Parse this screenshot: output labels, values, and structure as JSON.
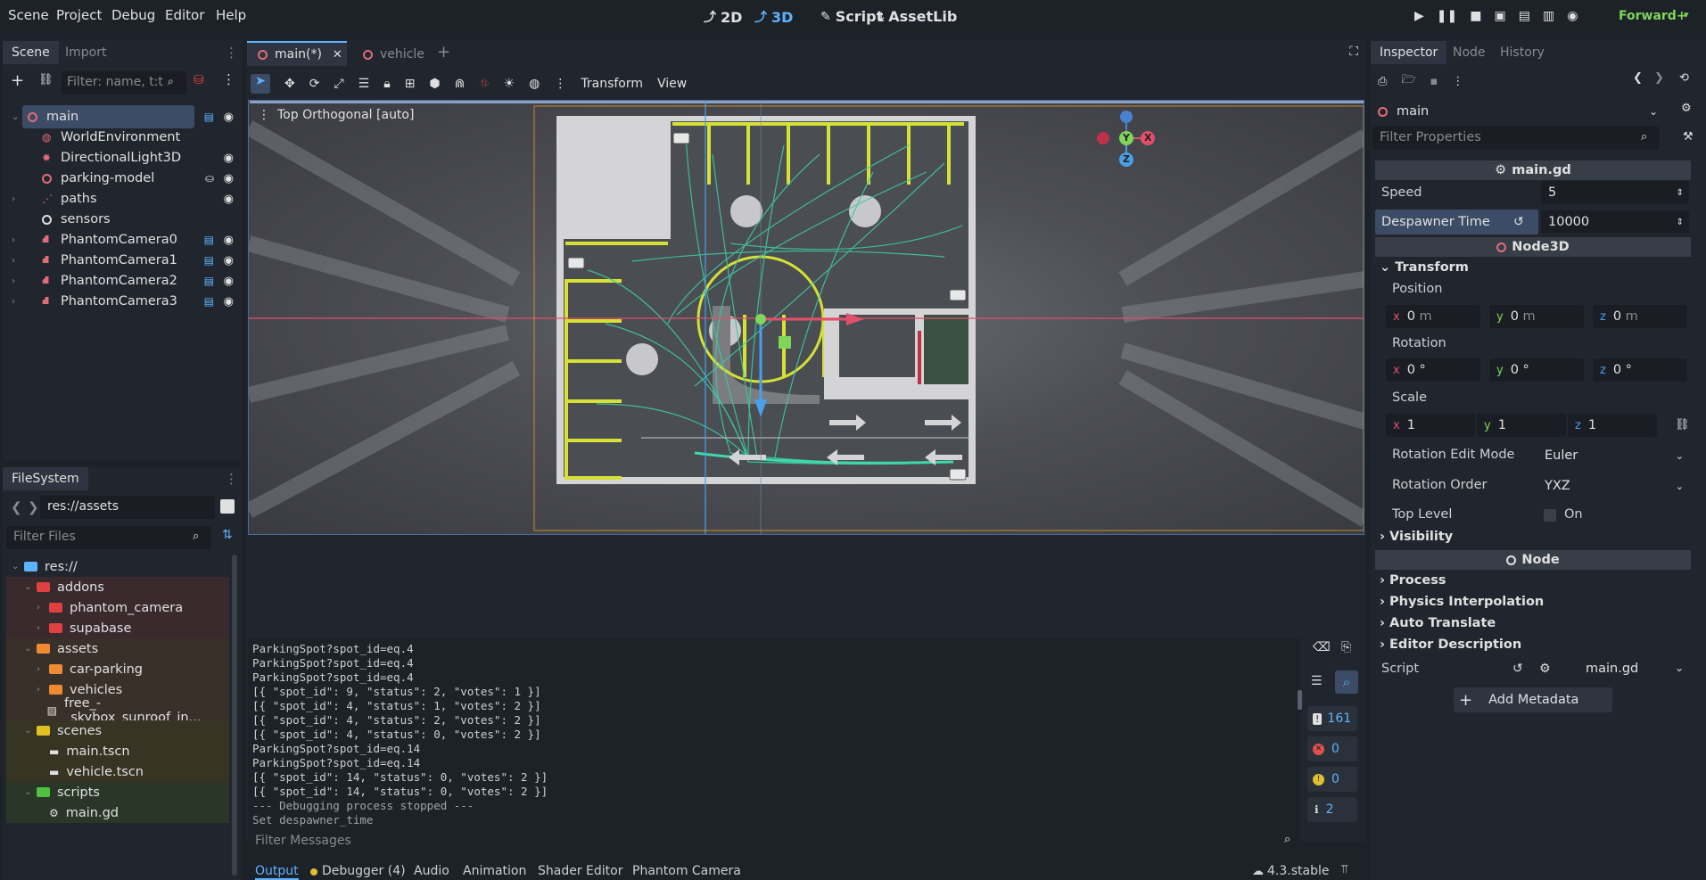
{
  "menu": [
    "Scene",
    "Project",
    "Debug",
    "Editor",
    "Help"
  ],
  "modes": {
    "mode_2d": "2D",
    "mode_3d": "3D",
    "script": "Script",
    "assetlib": "AssetLib"
  },
  "renderer": "Forward+",
  "scene_dock": {
    "tabs": [
      "Scene",
      "Import"
    ],
    "filter_placeholder": "Filter: name, t:t",
    "nodes": [
      {
        "name": "main",
        "eye": true,
        "script": true
      },
      {
        "name": "WorldEnvironment",
        "eye": false
      },
      {
        "name": "DirectionalLight3D",
        "eye": true
      },
      {
        "name": "parking-model",
        "eye": true
      },
      {
        "name": "paths",
        "eye": true
      },
      {
        "name": "sensors",
        "eye": false
      },
      {
        "name": "PhantomCamera0",
        "eye": true
      },
      {
        "name": "PhantomCamera1",
        "eye": true
      },
      {
        "name": "PhantomCamera2",
        "eye": true
      },
      {
        "name": "PhantomCamera3",
        "eye": true
      }
    ]
  },
  "filesystem": {
    "tab": "FileSystem",
    "path": "res://assets",
    "filter_placeholder": "Filter Files",
    "items": [
      {
        "name": "res://",
        "kind": "root",
        "depth": 0
      },
      {
        "name": "addons",
        "kind": "folder",
        "depth": 1,
        "color": "#e04040"
      },
      {
        "name": "phantom_camera",
        "kind": "folder",
        "depth": 2,
        "color": "#e04040"
      },
      {
        "name": "supabase",
        "kind": "folder",
        "depth": 2,
        "color": "#e04040"
      },
      {
        "name": "assets",
        "kind": "folder",
        "depth": 1,
        "color": "#f08a30"
      },
      {
        "name": "car-parking",
        "kind": "folder",
        "depth": 2,
        "color": "#f08a30"
      },
      {
        "name": "vehicles",
        "kind": "folder",
        "depth": 2,
        "color": "#f08a30"
      },
      {
        "name": "free_-_skybox_sunroof_in...",
        "kind": "file",
        "depth": 2
      },
      {
        "name": "scenes",
        "kind": "folder",
        "depth": 1,
        "color": "#e0c020"
      },
      {
        "name": "main.tscn",
        "kind": "file",
        "depth": 2
      },
      {
        "name": "vehicle.tscn",
        "kind": "file",
        "depth": 2
      },
      {
        "name": "scripts",
        "kind": "folder",
        "depth": 1,
        "color": "#50c040"
      },
      {
        "name": "main.gd",
        "kind": "file",
        "depth": 2
      }
    ]
  },
  "editor_tabs": [
    "main(*)",
    "vehicle"
  ],
  "toolbar": {
    "transform": "Transform",
    "view": "View"
  },
  "viewport": {
    "label": "Top Orthogonal [auto]",
    "gizmo": {
      "x": "X",
      "y": "Y",
      "z": "Z"
    }
  },
  "console": {
    "lines": [
      "ParkingSpot?spot_id=eq.4",
      "ParkingSpot?spot_id=eq.4",
      "ParkingSpot?spot_id=eq.4",
      "[{ \"spot_id\": 9, \"status\": 2, \"votes\": 1 }]",
      "[{ \"spot_id\": 4, \"status\": 1, \"votes\": 2 }]",
      "[{ \"spot_id\": 4, \"status\": 2, \"votes\": 2 }]",
      "[{ \"spot_id\": 4, \"status\": 0, \"votes\": 2 }]",
      "ParkingSpot?spot_id=eq.14",
      "ParkingSpot?spot_id=eq.14",
      "[{ \"spot_id\": 14, \"status\": 0, \"votes\": 2 }]",
      "[{ \"spot_id\": 14, \"status\": 0, \"votes\": 2 }]",
      "--- Debugging process stopped ---",
      "Set despawner_time"
    ],
    "filter_placeholder": "Filter Messages",
    "counts": {
      "messages": "161",
      "errors": "0",
      "warnings": "0",
      "info": "2"
    }
  },
  "bottom_tabs": [
    "Output",
    "Debugger (4)",
    "Audio",
    "Animation",
    "Shader Editor",
    "Phantom Camera"
  ],
  "version": "4.3.stable",
  "inspector": {
    "tabs": [
      "Inspector",
      "Node",
      "History"
    ],
    "node": "main",
    "filter_placeholder": "Filter Properties",
    "script_section": "main.gd",
    "speed_label": "Speed",
    "speed": "5",
    "despawner_label": "Despawner Time",
    "despawner": "10000",
    "node3d_section": "Node3D",
    "transform": "Transform",
    "position": "Position",
    "pos_x": "0",
    "pos_y": "0",
    "pos_z": "0",
    "unit_m": "m",
    "rotation": "Rotation",
    "rot_x": "0 °",
    "rot_y": "0 °",
    "rot_z": "0 °",
    "scale": "Scale",
    "sc_x": "1",
    "sc_y": "1",
    "sc_z": "1",
    "rot_mode_label": "Rotation Edit Mode",
    "rot_mode": "Euler",
    "rot_order_label": "Rotation Order",
    "rot_order": "YXZ",
    "top_level_label": "Top Level",
    "top_level": "On",
    "visibility": "Visibility",
    "node_section": "Node",
    "process": "Process",
    "physics_interp": "Physics Interpolation",
    "auto_translate": "Auto Translate",
    "editor_desc": "Editor Description",
    "script_label": "Script",
    "script_value": "main.gd",
    "add_metadata": "Add Metadata"
  }
}
